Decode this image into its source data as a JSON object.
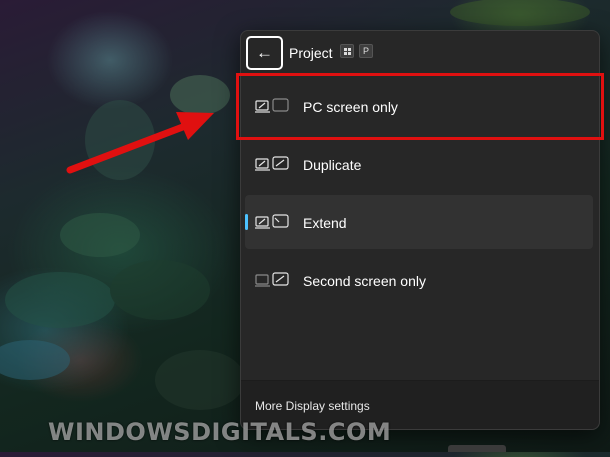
{
  "flyout": {
    "title": "Project",
    "shortcut_keys": [
      "win-key",
      "P"
    ],
    "options": [
      {
        "label": "PC screen only",
        "icon": "pc-screen-only-icon",
        "active": false
      },
      {
        "label": "Duplicate",
        "icon": "duplicate-icon",
        "active": false
      },
      {
        "label": "Extend",
        "icon": "extend-icon",
        "active": true
      },
      {
        "label": "Second screen only",
        "icon": "second-screen-only-icon",
        "active": false
      }
    ],
    "footer_link": "More Display settings"
  },
  "watermark": "WindowsDigitals.com",
  "colors": {
    "panel_bg": "#272727",
    "accent": "#4cc2ff",
    "highlight": "#e01010"
  }
}
